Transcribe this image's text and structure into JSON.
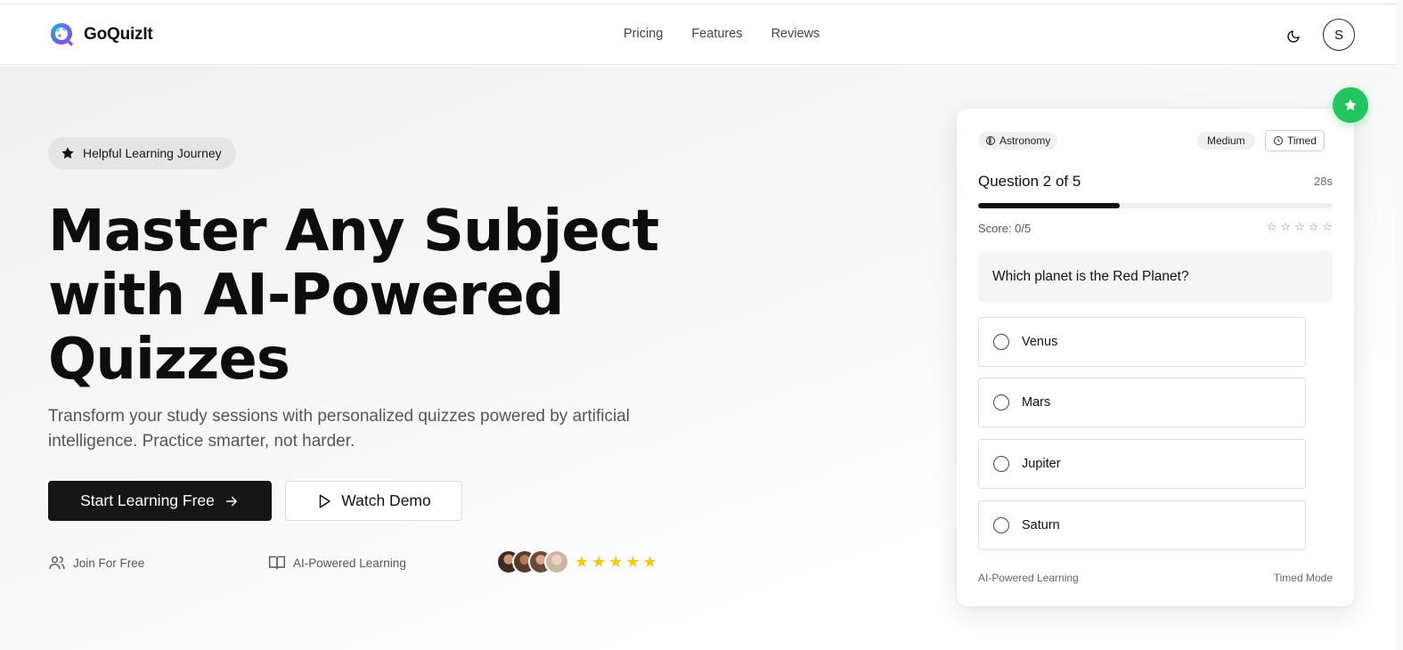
{
  "brand": {
    "name": "GoQuizIt"
  },
  "nav": {
    "items": [
      "Pricing",
      "Features",
      "Reviews"
    ]
  },
  "header": {
    "avatar_initial": "S"
  },
  "hero": {
    "pill_label": "Helpful Learning Journey",
    "title_line1": "Master Any Subject",
    "title_line2": "with AI-Powered",
    "title_line3": "Quizzes",
    "subtitle": "Transform your study sessions with personalized quizzes powered by artificial intelligence. Practice smarter, not harder.",
    "cta_primary": "Start Learning Free",
    "cta_secondary": "Watch Demo",
    "features": [
      {
        "label": "Join For Free",
        "icon": "users-icon"
      },
      {
        "label": "AI-Powered Learning",
        "icon": "book-icon"
      }
    ],
    "rating_stars": 5
  },
  "quiz": {
    "subject": "Astronomy",
    "difficulty": "Medium",
    "mode_tag": "Timed",
    "question_progress": "Question 2 of 5",
    "time_left": "28s",
    "progress_fraction": 0.4,
    "score": "Score: 0/5",
    "question": "Which planet is the Red Planet?",
    "options": [
      "Venus",
      "Mars",
      "Jupiter",
      "Saturn"
    ],
    "footer_left": "AI-Powered Learning",
    "footer_right": "Timed Mode"
  },
  "colors": {
    "accent_green": "#22c55e",
    "primary_dark": "#151515",
    "star_gold": "#f5c518"
  }
}
